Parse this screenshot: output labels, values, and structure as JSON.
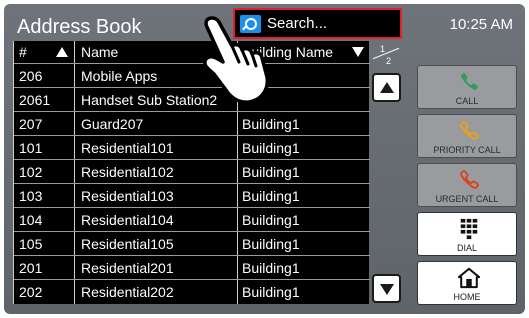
{
  "header": {
    "title": "Address Book",
    "clock": "10:25 AM"
  },
  "search": {
    "placeholder": "Search..."
  },
  "table": {
    "columns": {
      "number": "#",
      "name": "Name",
      "building": "Building Name"
    },
    "rows": [
      {
        "number": "206",
        "name": "Mobile Apps",
        "building": ""
      },
      {
        "number": "2061",
        "name": "Handset Sub Station2",
        "building": ""
      },
      {
        "number": "207",
        "name": "Guard207",
        "building": "Building1"
      },
      {
        "number": "101",
        "name": "Residential101",
        "building": "Building1"
      },
      {
        "number": "102",
        "name": "Residential102",
        "building": "Building1"
      },
      {
        "number": "103",
        "name": "Residential103",
        "building": "Building1"
      },
      {
        "number": "104",
        "name": "Residential104",
        "building": "Building1"
      },
      {
        "number": "105",
        "name": "Residential105",
        "building": "Building1"
      },
      {
        "number": "201",
        "name": "Residential201",
        "building": "Building1"
      },
      {
        "number": "202",
        "name": "Residential202",
        "building": "Building1"
      }
    ]
  },
  "pagination": {
    "current": "1",
    "total": "2"
  },
  "side_buttons": {
    "call": {
      "label": "CALL",
      "enabled": false,
      "icon_color": "#2e9e5e"
    },
    "priority_call": {
      "label": "PRIORITY CALL",
      "enabled": false,
      "icon_color": "#e8a21a"
    },
    "urgent_call": {
      "label": "URGENT CALL",
      "enabled": false,
      "icon_color": "#d9431e"
    },
    "dial": {
      "label": "DIAL",
      "enabled": true
    },
    "home": {
      "label": "HOME",
      "enabled": true
    }
  },
  "colors": {
    "search_highlight": "#e0202c",
    "search_icon_bg": "#1f8ee8",
    "table_bg": "#000000",
    "frame_bg": "#6a6f74"
  }
}
